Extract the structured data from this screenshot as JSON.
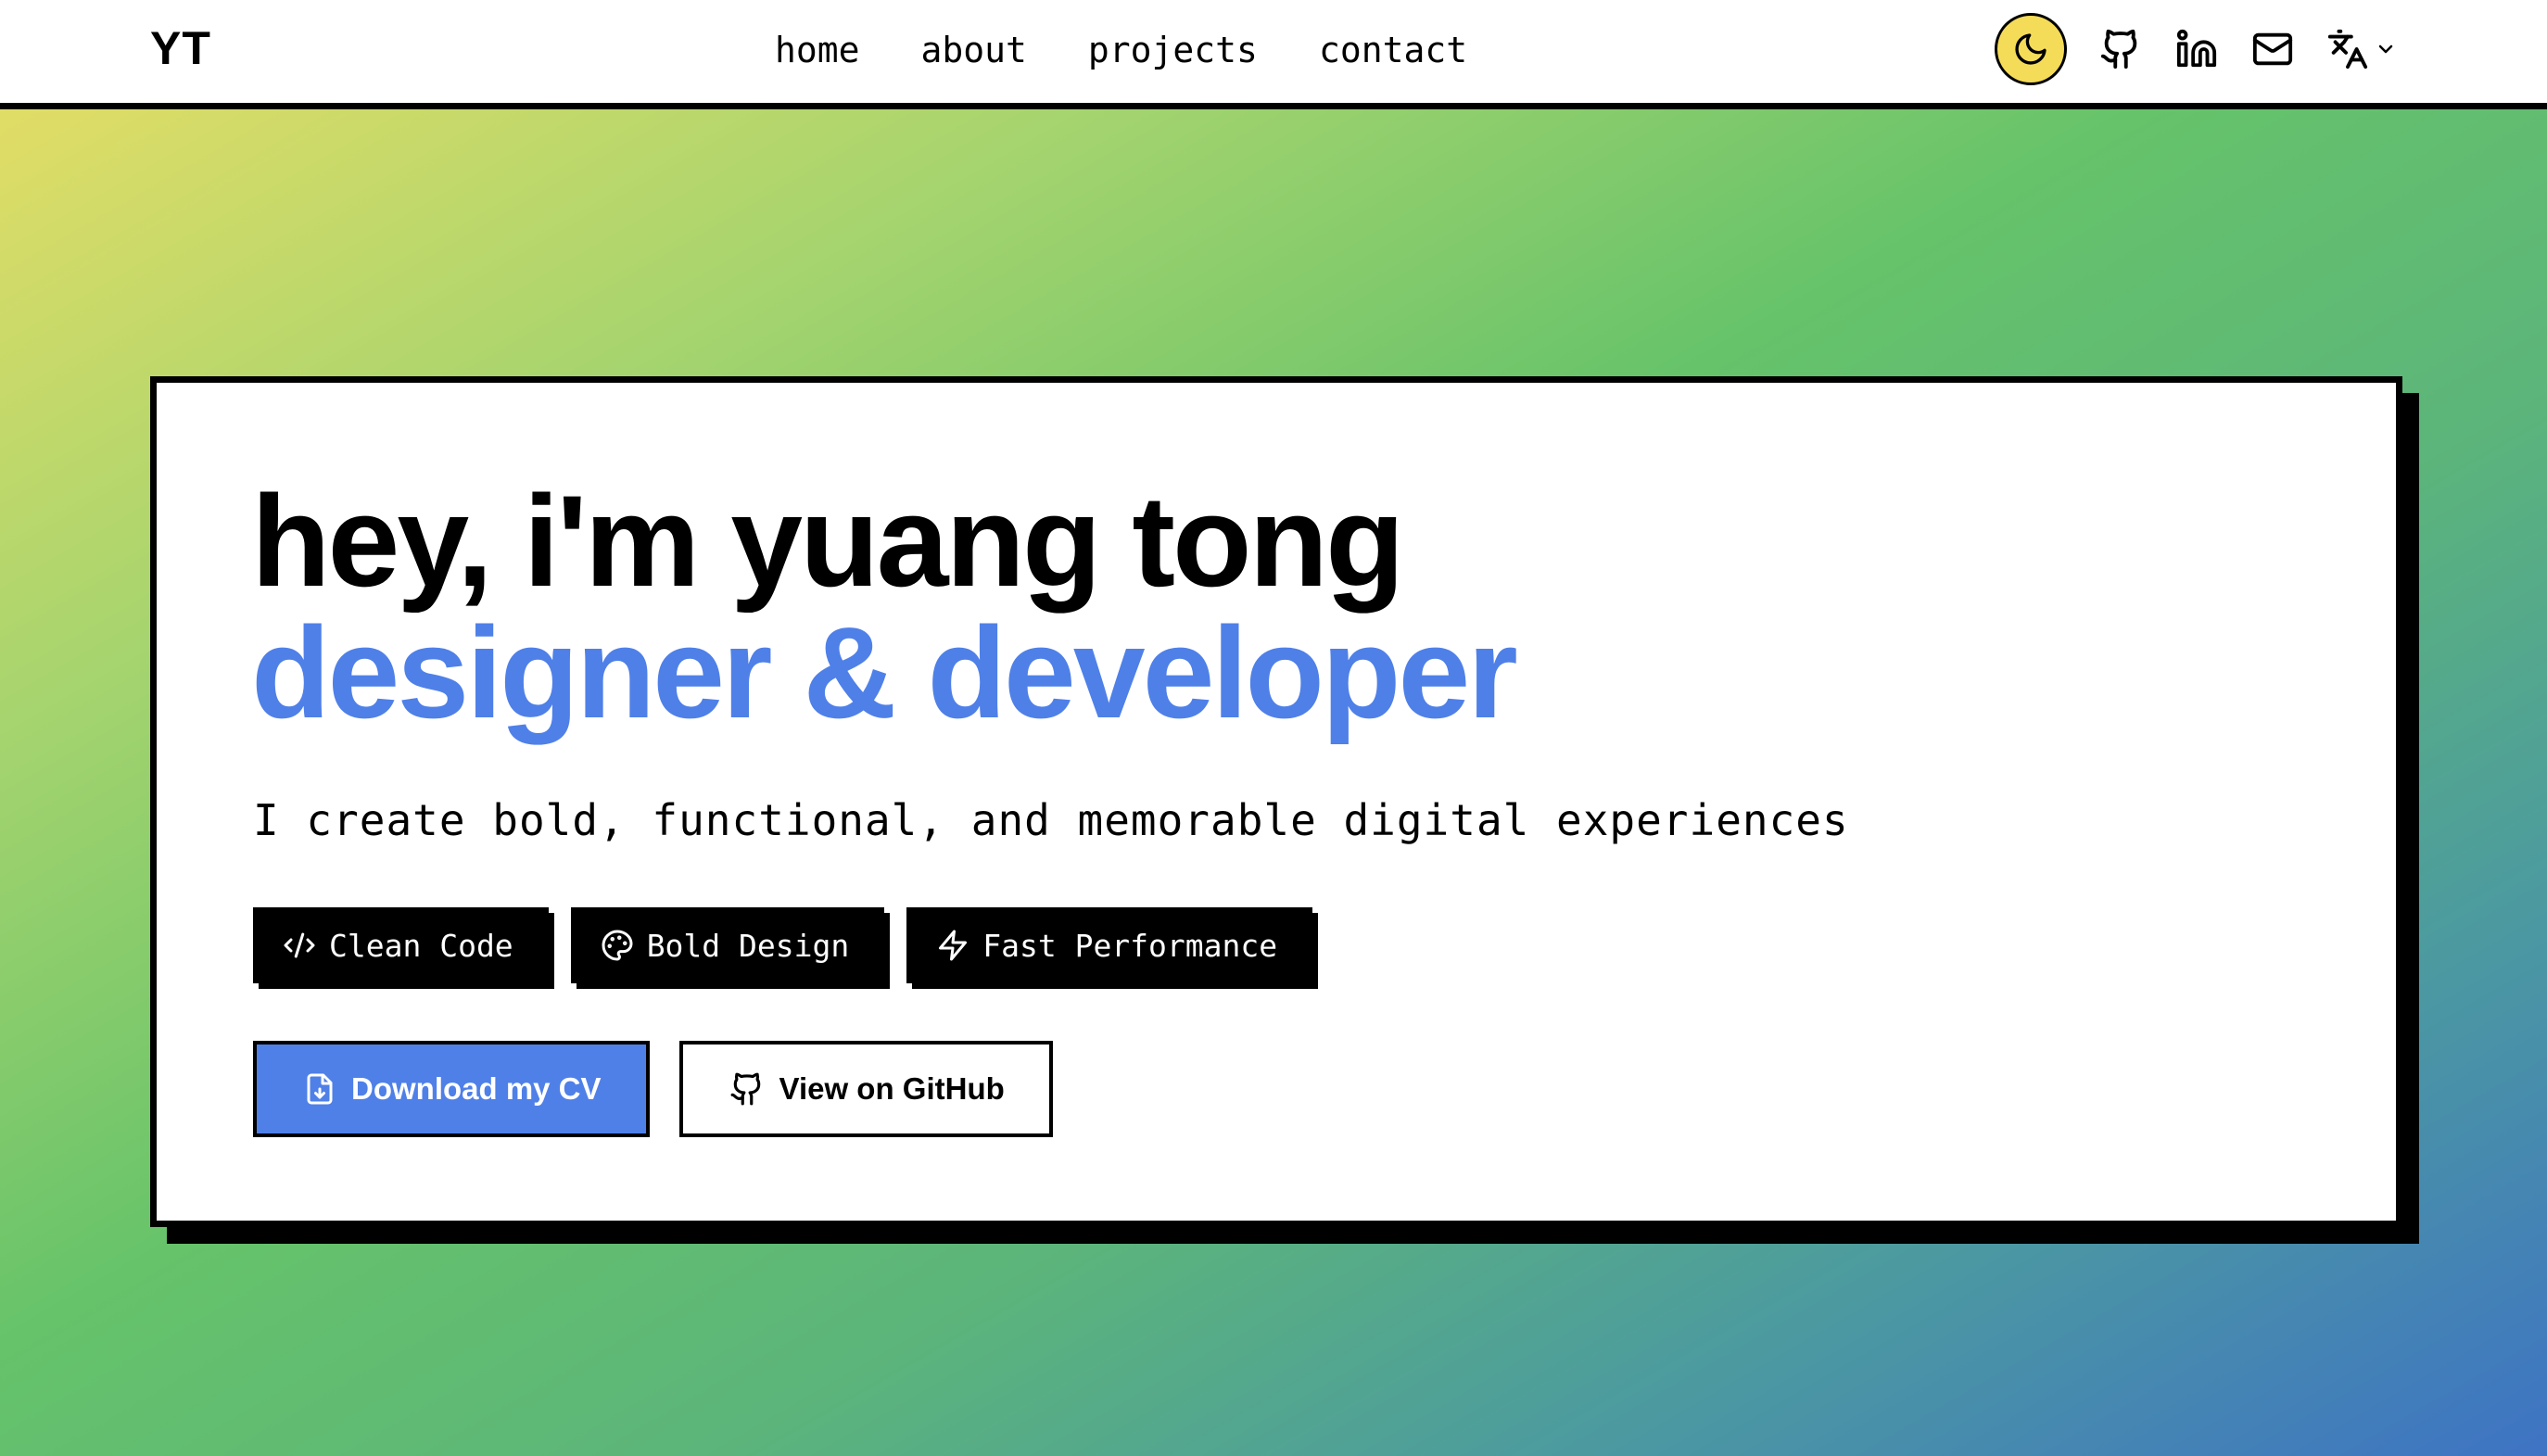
{
  "nav": {
    "logo": "YT",
    "links": [
      "home",
      "about",
      "projects",
      "contact"
    ],
    "icons": [
      "moon-icon",
      "github-icon",
      "linkedin-icon",
      "mail-icon",
      "translate-icon",
      "chevron-down-icon"
    ]
  },
  "hero": {
    "title": "hey, i'm yuang tong",
    "subtitle": "designer & developer",
    "description": "I create bold, functional, and memorable digital experiences",
    "tags": [
      {
        "label": "Clean Code",
        "icon": "code-icon"
      },
      {
        "label": "Bold Design",
        "icon": "palette-icon"
      },
      {
        "label": "Fast Performance",
        "icon": "zap-icon"
      }
    ],
    "buttons": {
      "primary": "Download my CV",
      "primary_icon": "file-download-icon",
      "secondary": "View on GitHub",
      "secondary_icon": "github-icon"
    }
  },
  "colors": {
    "accent": "#4f80e8",
    "toggle": "#f5dc58",
    "gradient_start": "#e1dd66",
    "gradient_mid": "#66c36a",
    "gradient_end": "#3e73c4"
  }
}
